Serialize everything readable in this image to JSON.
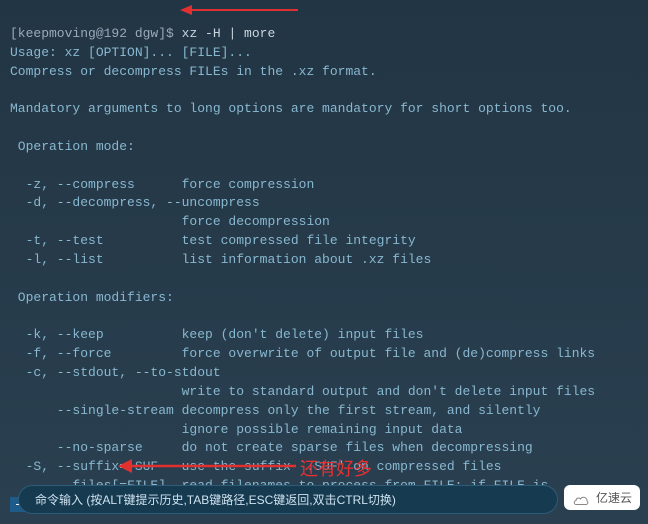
{
  "prompt": "[keepmoving@192 dgw]$ ",
  "command": "xz -H | more",
  "lines": [
    "Usage: xz [OPTION]... [FILE]...",
    "Compress or decompress FILEs in the .xz format.",
    "",
    "Mandatory arguments to long options are mandatory for short options too.",
    "",
    " Operation mode:",
    "",
    "  -z, --compress      force compression",
    "  -d, --decompress, --uncompress",
    "                      force decompression",
    "  -t, --test          test compressed file integrity",
    "  -l, --list          list information about .xz files",
    "",
    " Operation modifiers:",
    "",
    "  -k, --keep          keep (don't delete) input files",
    "  -f, --force         force overwrite of output file and (de)compress links",
    "  -c, --stdout, --to-stdout",
    "                      write to standard output and don't delete input files",
    "      --single-stream decompress only the first stream, and silently",
    "                      ignore possible remaining input data",
    "      --no-sparse     do not create sparse files when decompressing",
    "  -S, --suffix=.SUF   use the suffix `.SUF' on compressed files",
    "      --files[=FILE]  read filenames to process from FILE; if FILE is"
  ],
  "more_prompt": "--More--",
  "annotation": "还有好多",
  "input_hint": "命令输入 (按ALT键提示历史,TAB键路径,ESC键返回,双击CTRL切换)",
  "logo_text": "亿速云",
  "arrow_color": "#e03030"
}
